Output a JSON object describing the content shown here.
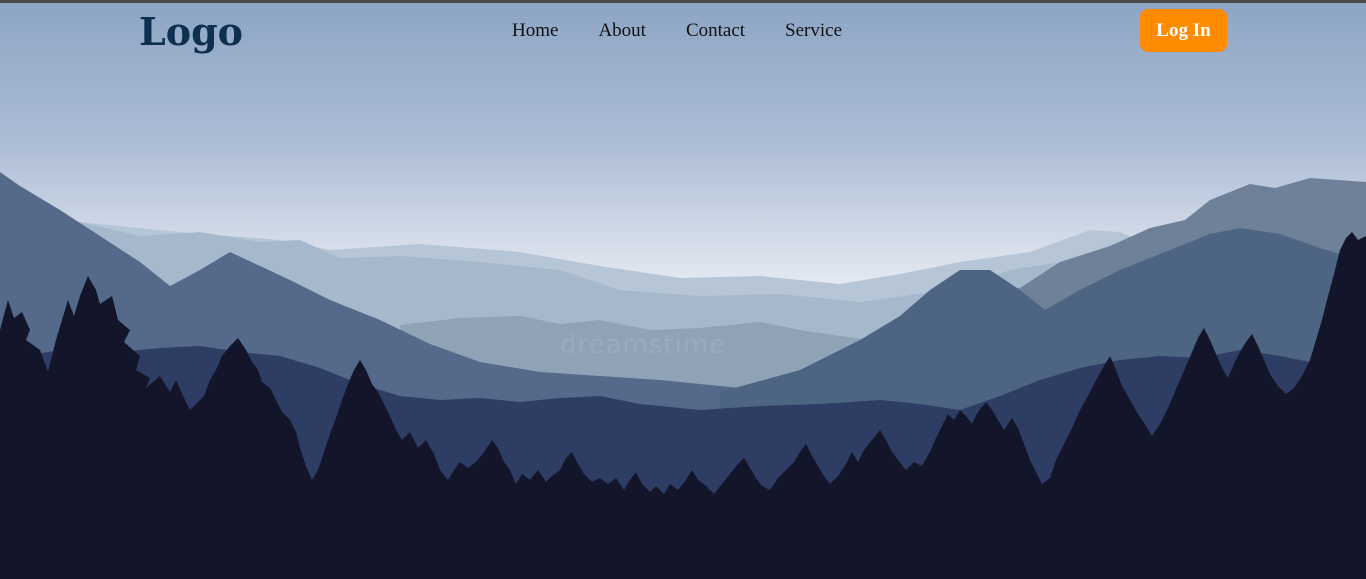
{
  "header": {
    "logo_text": "Logo",
    "nav": [
      {
        "label": "Home"
      },
      {
        "label": "About"
      },
      {
        "label": "Contact"
      },
      {
        "label": "Service"
      }
    ],
    "login_label": "Log In"
  },
  "hero": {
    "watermark": "dreamstime"
  },
  "colors": {
    "accent": "#ff8c00",
    "logo": "#0e2f4f",
    "sky_top": "#8ea6c6",
    "sky_horizon": "#e8ecf3",
    "forest": "#13152a"
  }
}
